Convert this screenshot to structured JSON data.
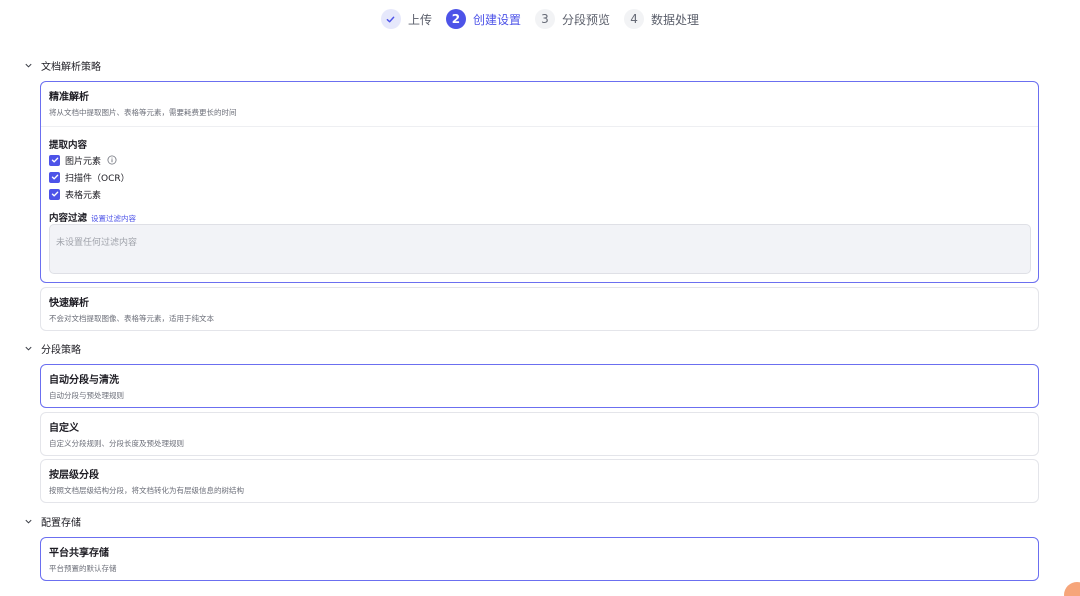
{
  "stepper": {
    "steps": [
      {
        "number": "✓",
        "label": "上传",
        "state": "done"
      },
      {
        "number": "2",
        "label": "创建设置",
        "state": "active"
      },
      {
        "number": "3",
        "label": "分段预览",
        "state": "todo"
      },
      {
        "number": "4",
        "label": "数据处理",
        "state": "todo"
      }
    ]
  },
  "parse_section": {
    "title": "文档解析策略",
    "precise": {
      "title": "精准解析",
      "desc": "将从文档中提取图片、表格等元素，需要耗费更长的时间",
      "extract_title": "提取内容",
      "options": [
        {
          "label": "图片元素",
          "checked": true
        },
        {
          "label": "扫描件（OCR）",
          "checked": true
        },
        {
          "label": "表格元素",
          "checked": true
        }
      ],
      "filter_title": "内容过滤",
      "filter_link": "设置过滤内容",
      "filter_placeholder": "未设置任何过滤内容"
    },
    "fast": {
      "title": "快速解析",
      "desc": "不会对文档提取图像、表格等元素，适用于纯文本"
    }
  },
  "segment_section": {
    "title": "分段策略",
    "options": [
      {
        "title": "自动分段与清洗",
        "desc": "自动分段与预处理规则"
      },
      {
        "title": "自定义",
        "desc": "自定义分段规则、分段长度及预处理规则"
      },
      {
        "title": "按层级分段",
        "desc": "按照文档层级结构分段，将文档转化为有层级信息的树结构"
      }
    ]
  },
  "storage_section": {
    "title": "配置存储",
    "option": {
      "title": "平台共享存储",
      "desc": "平台预置的默认存储"
    }
  },
  "colors": {
    "accent": "#4d53e8",
    "selected_border": "#6b6ff0"
  }
}
